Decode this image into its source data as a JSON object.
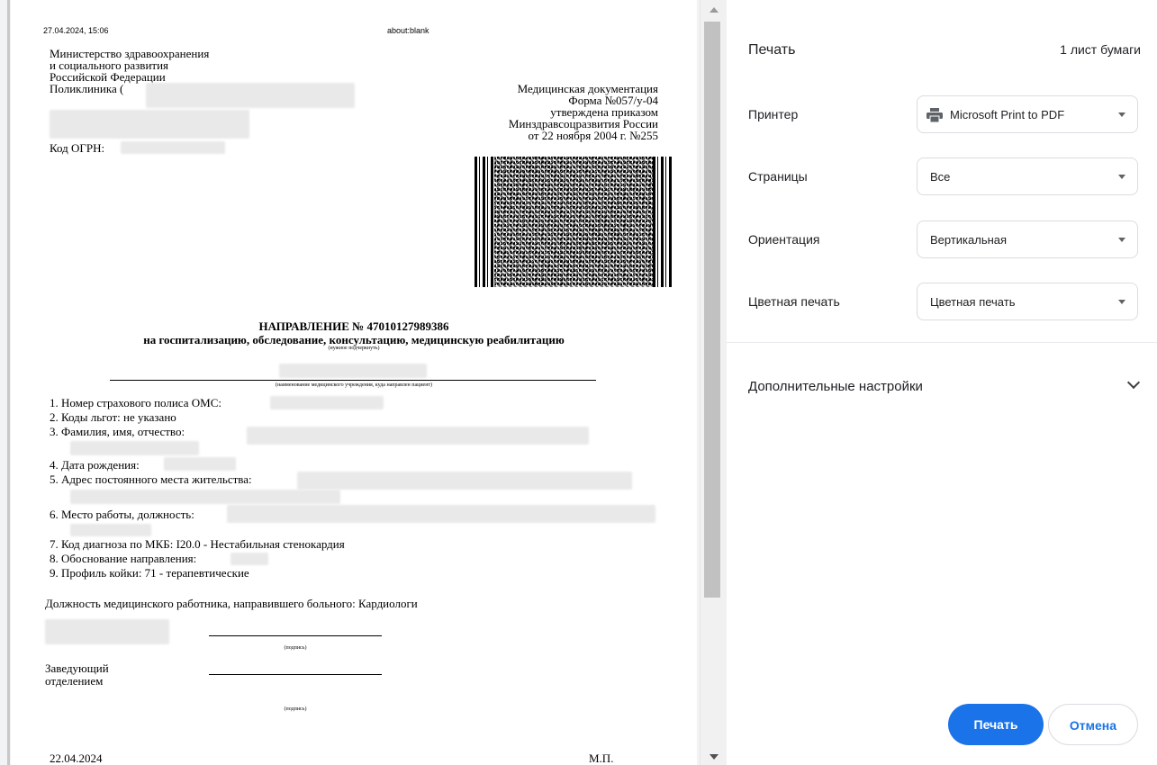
{
  "browser_header": {
    "timestamp": "27.04.2024, 15:06",
    "url": "about:blank"
  },
  "document": {
    "org_lines": [
      "Министерство здравоохранения",
      "и социального развития",
      "Российской Федерации",
      "Поликлиника ("
    ],
    "ogrn_label": "Код ОГРН:",
    "form_lines": [
      "Медицинская документация",
      "Форма №057/у-04",
      "утверждена приказом",
      "Минздравсоцразвития России",
      "от 22 ноября 2004 г. №255"
    ],
    "title": "НАПРАВЛЕНИЕ № 47010127989386",
    "subtitle": "на госпитализацию, обследование, консультацию, медицинскую реабилитацию",
    "hint_underline": "(нужное подчеркнуть)",
    "hint_institution": "(наименование медицинского учреждения, куда направлен пациент)",
    "items": [
      "1. Номер страхового полиса ОМС:",
      "2. Коды льгот: не указано",
      "3. Фамилия, имя, отчество:",
      "4. Дата рождения:",
      "5. Адрес постоянного места жительства:",
      "6. Место работы, должность:",
      "7. Код диагноза по МКБ: I20.0 - Нестабильная стенокардия",
      "8. Обоснование направления:",
      "9. Профиль койки: 71 - терапевтические"
    ],
    "position_line": "Должность медицинского работника, направившего больного: Кардиологи",
    "signature_hint": "(подпись)",
    "head_label_1": "Заведующий",
    "head_label_2": "отделением",
    "date": "22.04.2024",
    "stamp": "М.П."
  },
  "panel": {
    "title": "Печать",
    "sheet_count": "1 лист бумаги",
    "printer_label": "Принтер",
    "printer_value": "Microsoft Print to PDF",
    "pages_label": "Страницы",
    "pages_value": "Все",
    "orientation_label": "Ориентация",
    "orientation_value": "Вертикальная",
    "color_label": "Цветная печать",
    "color_value": "Цветная печать",
    "more_settings": "Дополнительные настройки",
    "print_button": "Печать",
    "cancel_button": "Отмена",
    "printer_icon": "printer-icon",
    "accent_color": "#1a73e8"
  }
}
